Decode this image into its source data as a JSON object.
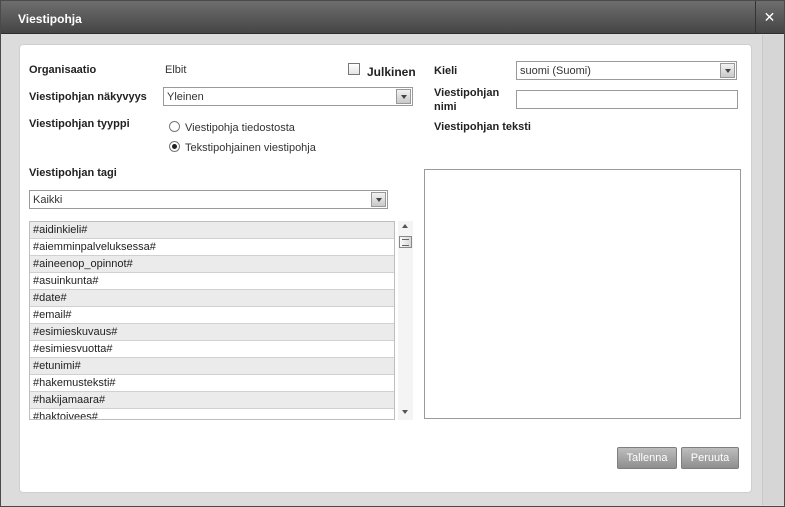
{
  "dialog": {
    "title": "Viestipohja",
    "close_glyph": "✕"
  },
  "form": {
    "organisation_label": "Organisaatio",
    "organisation_value": "Elbit",
    "public_label": "Julkinen",
    "public_checked": false,
    "visibility_label": "Viestipohjan näkyvyys",
    "visibility_value": "Yleinen",
    "type_label": "Viestipohjan tyyppi",
    "type_options": [
      "Viestipohja tiedostosta",
      "Tekstipohjainen viestipohja"
    ],
    "type_selected_index": 1,
    "language_label": "Kieli",
    "language_value": "suomi (Suomi)",
    "name_label_line1": "Viestipohjan",
    "name_label_line2": "nimi",
    "name_value": "",
    "text_label": "Viestipohjan teksti",
    "text_value": ""
  },
  "tags": {
    "label": "Viestipohjan tagi",
    "filter_value": "Kaikki",
    "items": [
      "#aidinkieli#",
      "#aiemminpalveluksessa#",
      "#aineenop_opinnot#",
      "#asuinkunta#",
      "#date#",
      "#email#",
      "#esimieskuvaus#",
      "#esimiesvuotta#",
      "#etunimi#",
      "#hakemusteksti#",
      "#hakijamaara#",
      "#haktoivees#"
    ]
  },
  "buttons": {
    "save": "Tallenna",
    "cancel": "Peruuta"
  },
  "icons": {
    "close": "close-icon",
    "dropdown": "chevron-down-icon",
    "scroll_up": "scroll-up-icon",
    "scroll_down": "scroll-down-icon"
  }
}
